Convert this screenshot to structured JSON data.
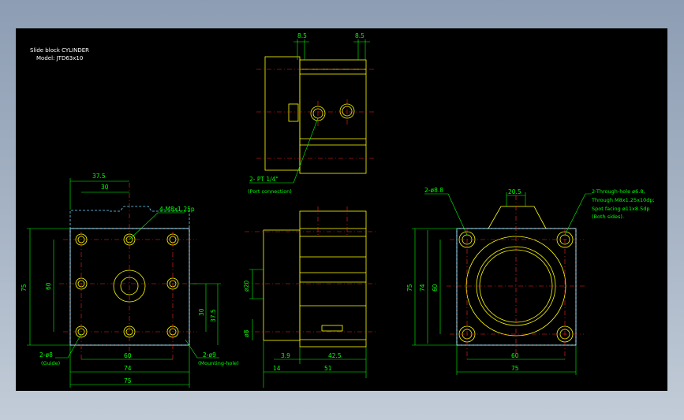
{
  "title": {
    "line1": "Slide block CYLINDER",
    "line2": "Model: JTD63x10"
  },
  "top_view": {
    "dim_left": "8.5",
    "dim_right": "8.5",
    "port_label": "2- PT 1/4\"",
    "port_sub": "(Port connection)"
  },
  "left_view": {
    "dim_37_5_top": "37.5",
    "dim_30_top": "30",
    "tap_label": "4-M8x1.25p",
    "dim_75_left": "75",
    "dim_60_left": "60",
    "dim_30_right": "30",
    "dim_37_5_right": "37.5",
    "guide_label": "2-ø8",
    "guide_sub": "(Guide)",
    "mount_label": "2-ø9",
    "mount_sub": "(Mounting-hole)",
    "dim_60_bottom": "60",
    "dim_74_bottom": "74",
    "dim_75_bottom": "75"
  },
  "side_view": {
    "dim_phi20": "ø20",
    "dim_phi8": "ø8",
    "dim_3_9": "3.9",
    "dim_42_5": "42.5",
    "dim_14": "14",
    "dim_51": "51"
  },
  "right_view": {
    "hole_label": "2-ø8.8",
    "dim_20_5": "20.5",
    "note_line1": "2-Through-hole ø6.8,",
    "note_line2": "Through M8x1.25x10dp;",
    "note_line3": "Spot facing ø11x8.5dp",
    "note_line4": "(Both sides).",
    "dim_75_left": "75",
    "dim_74_left": "74",
    "dim_60_left": "60",
    "dim_60_bottom": "60",
    "dim_75_bottom": "75"
  },
  "colors": {
    "background": "#000000",
    "dimension": "#00ff00",
    "centerline": "#ff2020",
    "outline": "#ffff00",
    "hidden": "#6ad7ff"
  }
}
